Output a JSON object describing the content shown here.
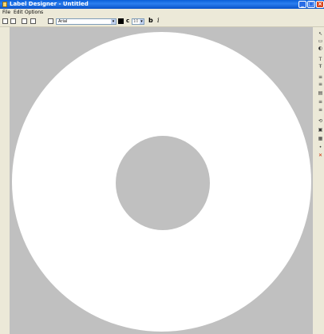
{
  "window": {
    "title": "Label Designer - Untitled",
    "min_glyph": "_",
    "max_glyph": "□",
    "close_glyph": "×"
  },
  "menu": {
    "items": [
      "File",
      "Edit",
      "Options"
    ]
  },
  "toolbar": {
    "font_value": "Arial",
    "size_value": "10",
    "bold_label": "b",
    "italic_label": "i",
    "size_icon_glyph": "c",
    "color_value": "#000000",
    "icons": [
      "new-icon",
      "open-icon",
      "save-icon",
      "copy-icon",
      "print-icon"
    ]
  },
  "canvas": {
    "background": "#c0c0c0",
    "disc_color": "#ffffff"
  },
  "palette": {
    "items": [
      {
        "name": "pointer-tool-icon",
        "glyph": "↖"
      },
      {
        "name": "select-tool-icon",
        "glyph": "▭"
      },
      {
        "name": "image-tool-icon",
        "glyph": "◐"
      },
      {
        "name": "text-tool-icon",
        "glyph": "T"
      },
      {
        "name": "curved-text-tool-icon",
        "glyph": "Ŧ"
      },
      {
        "name": "align-left-icon",
        "glyph": "≡"
      },
      {
        "name": "align-right-icon",
        "glyph": "≡"
      },
      {
        "name": "layer-icon",
        "glyph": "▤"
      },
      {
        "name": "list-icon",
        "glyph": "≡"
      },
      {
        "name": "list-2-icon",
        "glyph": "≡"
      },
      {
        "name": "rotate-icon",
        "glyph": "⟲"
      },
      {
        "name": "lock-icon",
        "glyph": "▣"
      },
      {
        "name": "grid-icon",
        "glyph": "▦"
      },
      {
        "name": "pin-icon",
        "glyph": "•"
      },
      {
        "name": "delete-icon",
        "glyph": "✕"
      }
    ]
  }
}
